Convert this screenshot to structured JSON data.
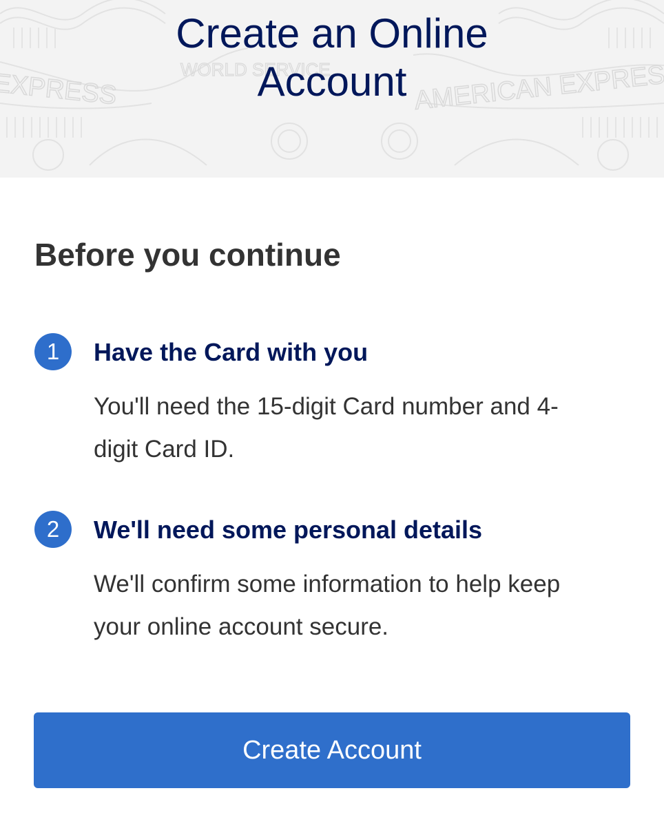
{
  "header": {
    "title_line1": "Create an Online",
    "title_line2": "Account",
    "background_color": "#f3f3f3",
    "title_color": "#00175a",
    "watermark_left": "EXPRESS",
    "watermark_center": "WORLD SERVICE",
    "watermark_right": "AMERICAN EXPRESS"
  },
  "main": {
    "heading": "Before you continue",
    "steps": [
      {
        "number": "1",
        "title": "Have the Card with you",
        "desc_line1": "You'll need the 15-digit Card number and 4-",
        "desc_line2": "digit Card ID."
      },
      {
        "number": "2",
        "title": "We'll need some personal details",
        "desc_line1": "We'll confirm some information to help keep",
        "desc_line2": "your online account secure."
      }
    ]
  },
  "actions": {
    "create_account_label": "Create Account",
    "button_color": "#2f6fcb"
  }
}
